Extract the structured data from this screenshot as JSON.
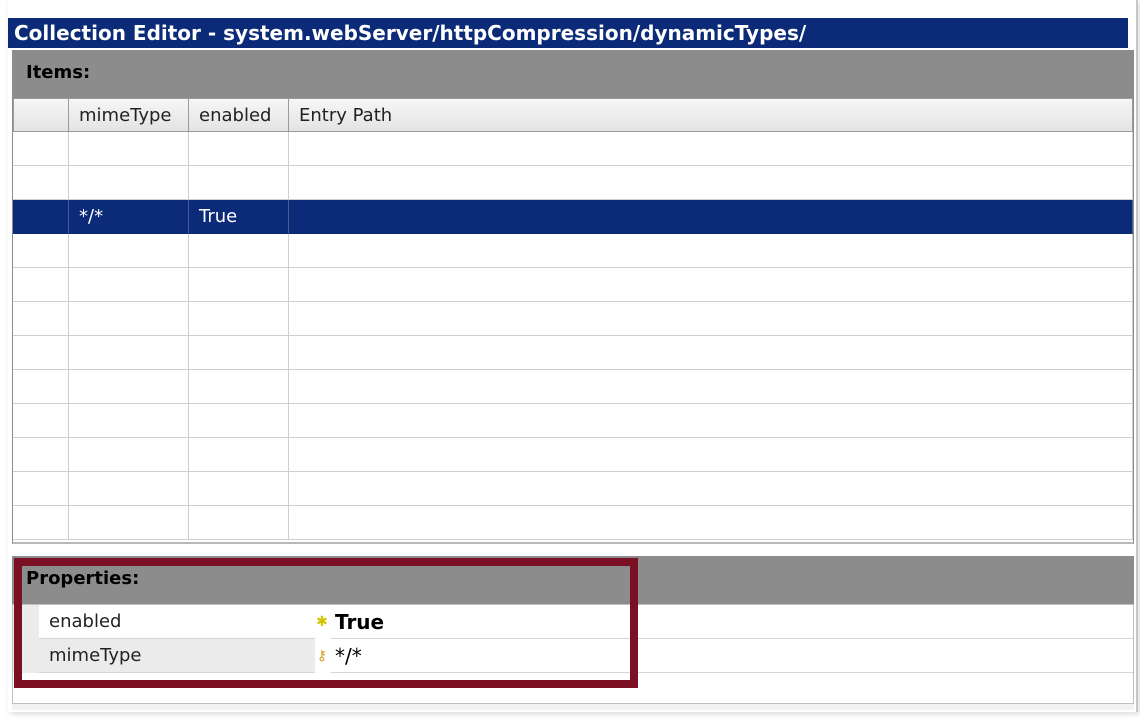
{
  "window": {
    "title": "Collection Editor - system.webServer/httpCompression/dynamicTypes/"
  },
  "items": {
    "label": "Items:",
    "columns": [
      "",
      "mimeType",
      "enabled",
      "Entry Path"
    ],
    "rows": [
      {
        "mimeType": "",
        "enabled": "",
        "entry_path": "",
        "selected": false
      },
      {
        "mimeType": "",
        "enabled": "",
        "entry_path": "",
        "selected": false
      },
      {
        "mimeType": "*/*",
        "enabled": "True",
        "entry_path": "",
        "selected": true
      },
      {
        "mimeType": "",
        "enabled": "",
        "entry_path": "",
        "selected": false
      },
      {
        "mimeType": "",
        "enabled": "",
        "entry_path": "",
        "selected": false
      },
      {
        "mimeType": "",
        "enabled": "",
        "entry_path": "",
        "selected": false
      },
      {
        "mimeType": "",
        "enabled": "",
        "entry_path": "",
        "selected": false
      },
      {
        "mimeType": "",
        "enabled": "",
        "entry_path": "",
        "selected": false
      },
      {
        "mimeType": "",
        "enabled": "",
        "entry_path": "",
        "selected": false
      },
      {
        "mimeType": "",
        "enabled": "",
        "entry_path": "",
        "selected": false
      },
      {
        "mimeType": "",
        "enabled": "",
        "entry_path": "",
        "selected": false
      },
      {
        "mimeType": "",
        "enabled": "",
        "entry_path": "",
        "selected": false
      }
    ]
  },
  "properties": {
    "label": "Properties:",
    "rows": [
      {
        "name": "enabled",
        "icon": "required-asterisk-icon",
        "icon_glyph": "✱",
        "value": "True"
      },
      {
        "name": "mimeType",
        "icon": "key-icon",
        "icon_glyph": "⚷",
        "value": "*/*"
      }
    ]
  },
  "colors": {
    "title_bar": "#0b2a78",
    "selection": "#0b2a78",
    "section_header": "#8c8c8c",
    "highlight_box": "#7b1024"
  }
}
